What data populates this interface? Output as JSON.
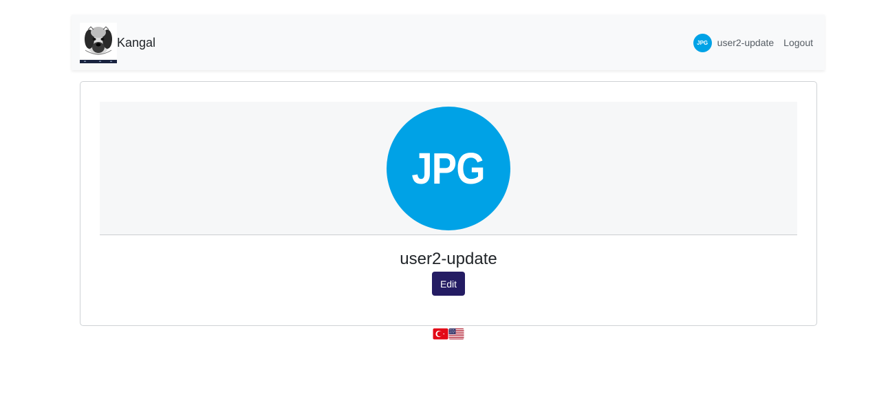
{
  "navbar": {
    "brand_name": "Kangal",
    "brand_logo_icon": "kangal-dog-icon",
    "user": {
      "avatar_text": "JPG",
      "avatar_color": "#00a2e6",
      "username": "user2-update"
    },
    "logout_label": "Logout"
  },
  "profile": {
    "avatar_text": "JPG",
    "avatar_color": "#00a2e6",
    "username": "user2-update",
    "edit_label": "Edit",
    "edit_color": "#241c63"
  },
  "languages": [
    {
      "icon": "turkey-flag-icon"
    },
    {
      "icon": "usa-flag-icon"
    }
  ]
}
